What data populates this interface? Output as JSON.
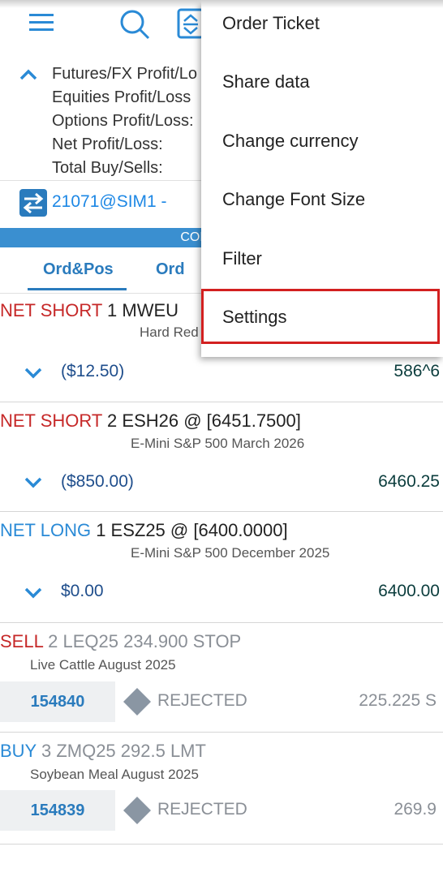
{
  "menu": {
    "items": [
      {
        "label": "Order Ticket"
      },
      {
        "label": "Share data"
      },
      {
        "label": "Change currency"
      },
      {
        "label": "Change Font Size"
      },
      {
        "label": "Filter"
      },
      {
        "label": "Settings"
      }
    ],
    "highlighted_item": "Settings",
    "highlight_color": "#d32020"
  },
  "toolbar": {
    "icons": [
      "hamburger-menu-icon",
      "search-icon",
      "sort-icon"
    ]
  },
  "summary": {
    "lines": [
      "Futures/FX Profit/Lo",
      "Equities Profit/Loss",
      "Options Profit/Loss:",
      "Net Profit/Loss:",
      "Total Buy/Sells:"
    ]
  },
  "account": {
    "label": "21071@SIM1 -",
    "connection_status": "CONNECTED"
  },
  "tabs": [
    {
      "label": "Ord&Pos",
      "active": true
    },
    {
      "label": "Ord",
      "active": false
    }
  ],
  "positions": [
    {
      "side": "NET SHORT",
      "detail": "1 MWEU",
      "description": "Hard Red",
      "pl": "($12.50)",
      "price": "586^6"
    },
    {
      "side": "NET SHORT",
      "detail": "2 ESH26 @ [6451.7500]",
      "description": "E-Mini S&P 500 March 2026",
      "pl": "($850.00)",
      "price": "6460.25"
    },
    {
      "side": "NET LONG",
      "detail": "1 ESZ25 @ [6400.0000]",
      "description": "E-Mini S&P 500 December 2025",
      "pl": "$0.00",
      "price": "6400.00"
    }
  ],
  "orders": [
    {
      "side": "SELL",
      "detail": "2 LEQ25 234.900 STOP",
      "description": "Live Cattle August 2025",
      "id": "154840",
      "status": "REJECTED",
      "price": "225.225 S"
    },
    {
      "side": "BUY",
      "detail": "3 ZMQ25 292.5 LMT",
      "description": "Soybean Meal August 2025",
      "id": "154839",
      "status": "REJECTED",
      "price": "269.9"
    }
  ],
  "colors": {
    "accent": "#2a7bbd",
    "net_short": "#c62828",
    "net_long": "#2a8ad6",
    "connected_bar": "#3a8fd0"
  }
}
